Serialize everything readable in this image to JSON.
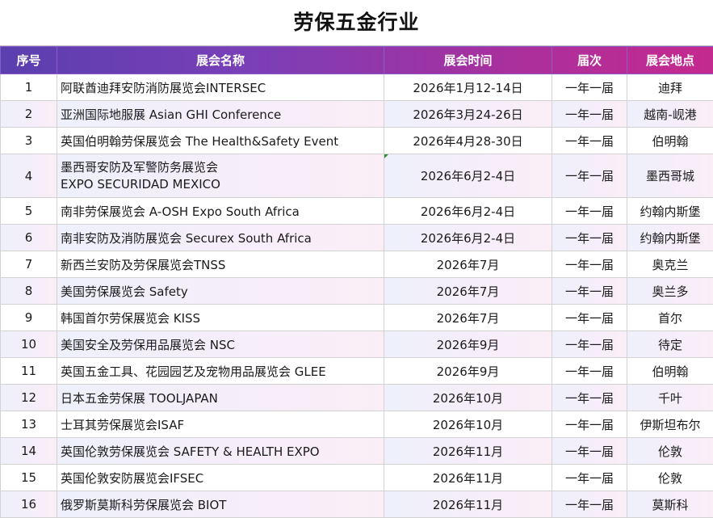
{
  "title": "劳保五金行业",
  "columns": [
    "序号",
    "展会名称",
    "展会时间",
    "届次",
    "展会地点"
  ],
  "rows": [
    {
      "no": "1",
      "name": [
        "阿联酋迪拜安防消防展览会INTERSEC"
      ],
      "date": "2026年1月12-14日",
      "freq": "一年一届",
      "place": "迪拜"
    },
    {
      "no": "2",
      "name": [
        "亚洲国际地服展 Asian GHI Conference"
      ],
      "date": "2026年3月24-26日",
      "freq": "一年一届",
      "place": "越南-岘港"
    },
    {
      "no": "3",
      "name": [
        "英国伯明翰劳保展览会 The Health&Safety Event"
      ],
      "date": "2026年4月28-30日",
      "freq": "一年一届",
      "place": "伯明翰"
    },
    {
      "no": "4",
      "name": [
        "墨西哥安防及军警防务展览会",
        " EXPO SECURIDAD MEXICO"
      ],
      "date": "2026年6月2-4日",
      "freq": "一年一届",
      "place": "墨西哥城"
    },
    {
      "no": "5",
      "name": [
        "南非劳保展览会 A-OSH Expo South Africa"
      ],
      "date": "2026年6月2-4日",
      "freq": "一年一届",
      "place": "约翰内斯堡"
    },
    {
      "no": "6",
      "name": [
        "南非安防及消防展览会 Securex South Africa"
      ],
      "date": "2026年6月2-4日",
      "freq": "一年一届",
      "place": "约翰内斯堡"
    },
    {
      "no": "7",
      "name": [
        "新西兰安防及劳保展览会TNSS"
      ],
      "date": "2026年7月",
      "freq": "一年一届",
      "place": "奥克兰"
    },
    {
      "no": "8",
      "name": [
        "美国劳保展览会 Safety"
      ],
      "date": "2026年7月",
      "freq": "一年一届",
      "place": "奥兰多"
    },
    {
      "no": "9",
      "name": [
        "韩国首尔劳保展览会 KISS"
      ],
      "date": "2026年7月",
      "freq": "一年一届",
      "place": "首尔"
    },
    {
      "no": "10",
      "name": [
        "美国安全及劳保用品展览会 NSC"
      ],
      "date": "2026年9月",
      "freq": "一年一届",
      "place": "待定"
    },
    {
      "no": "11",
      "name": [
        "英国五金工具、花园园艺及宠物用品展览会 GLEE"
      ],
      "date": "2026年9月",
      "freq": "一年一届",
      "place": "伯明翰"
    },
    {
      "no": "12",
      "name": [
        "日本五金劳保展 TOOLJAPAN"
      ],
      "date": "2026年10月",
      "freq": "一年一届",
      "place": "千叶"
    },
    {
      "no": "13",
      "name": [
        "士耳其劳保展览会ISAF"
      ],
      "date": "2026年10月",
      "freq": "一年一届",
      "place": "伊斯坦布尔"
    },
    {
      "no": "14",
      "name": [
        "英国伦敦劳保展览会 SAFETY & HEALTH EXPO"
      ],
      "date": "2026年11月",
      "freq": "一年一届",
      "place": "伦敦"
    },
    {
      "no": "15",
      "name": [
        "英国伦敦安防展览会IFSEC"
      ],
      "date": "2026年11月",
      "freq": "一年一届",
      "place": "伦敦"
    },
    {
      "no": "16",
      "name": [
        "俄罗斯莫斯科劳保展览会 BIOT"
      ],
      "date": "2026年11月",
      "freq": "一年一届",
      "place": "莫斯科"
    }
  ],
  "colors": {
    "header_gradient_start": "#5a3fae",
    "header_gradient_end": "#c52a8e",
    "stripe": "#f3eefa"
  }
}
